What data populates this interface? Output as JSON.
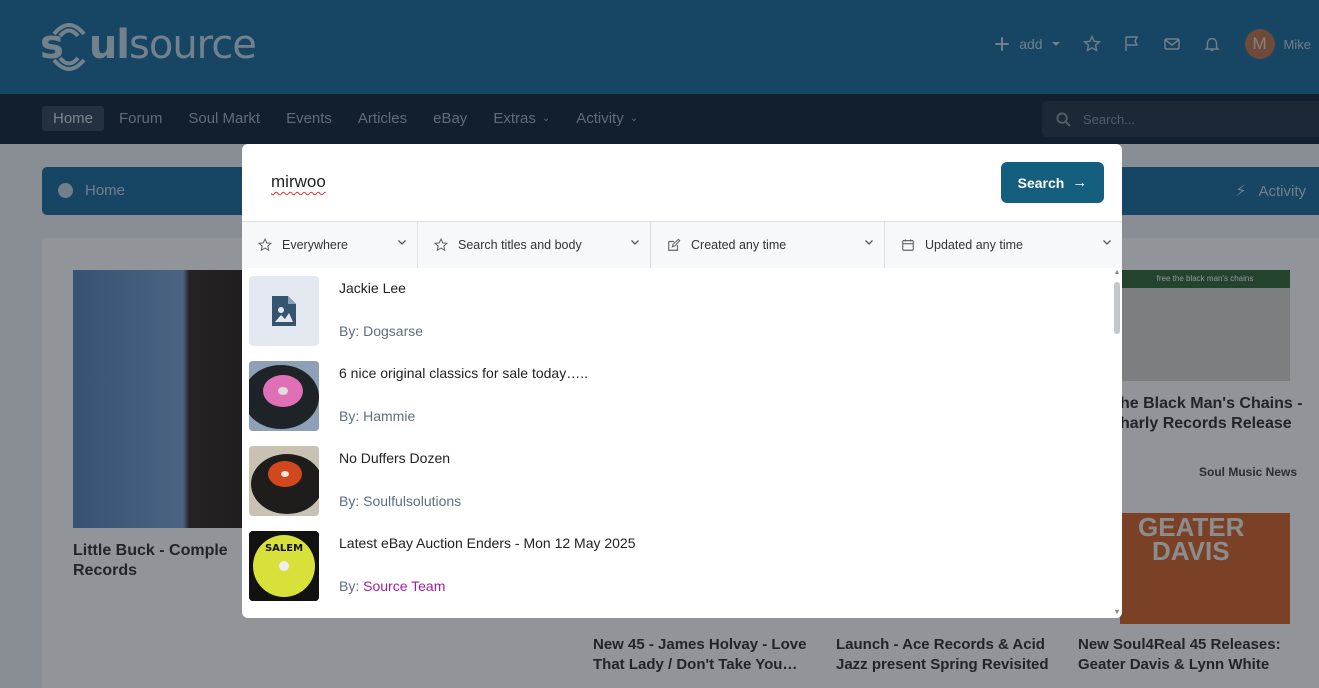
{
  "header": {
    "logo_left": "s",
    "logo_mid": "ul",
    "logo_right": "source",
    "add_label": "add",
    "user_initial": "M",
    "user_name": "Mike",
    "icons": [
      "plus-icon",
      "chevron-down-icon",
      "star-icon",
      "flag-icon",
      "envelope-icon",
      "bell-icon"
    ]
  },
  "nav": {
    "items": [
      {
        "label": "Home",
        "active": true
      },
      {
        "label": "Forum"
      },
      {
        "label": "Soul Markt"
      },
      {
        "label": "Events"
      },
      {
        "label": "Articles"
      },
      {
        "label": "eBay"
      },
      {
        "label": "Extras",
        "dropdown": true
      },
      {
        "label": "Activity",
        "dropdown": true
      }
    ],
    "search_placeholder": "Search..."
  },
  "breadcrumb": {
    "home": "Home",
    "activity": "Activity"
  },
  "background_cards": {
    "card1_title": "Little Buck - Comple",
    "card1_title2": "Records",
    "card2_title": "New 45 - James Holvay - Love",
    "card2_title2": "That Lady / Don't Take You…",
    "card3_title": "Launch - Ace Records & Acid",
    "card3_title2": "Jazz present Spring Revisited",
    "card4_title": "New Soul4Real 45 Releases:",
    "card4_title2": "Geater Davis & Lynn White",
    "card5_title": "he Black Man's Chains -",
    "card5_title2": "harly Records Release",
    "card5_tag": "Soul Music News",
    "thumb_text_1": "free the black man's chains",
    "thumb_text_2": "GEATER",
    "thumb_text_3": "DAVIS"
  },
  "search_modal": {
    "query": "mirwoo",
    "button_label": "Search",
    "filters": [
      {
        "label": "Everywhere",
        "icon": "star-icon"
      },
      {
        "label": "Search titles and body",
        "icon": "star-icon"
      },
      {
        "label": "Created any time",
        "icon": "edit-icon"
      },
      {
        "label": "Updated any time",
        "icon": "calendar-icon"
      }
    ],
    "results": [
      {
        "title": "Jackie Lee",
        "by_prefix": "By:",
        "author": "Dogsarse",
        "staff": false,
        "thumb": "placeholder-image-icon"
      },
      {
        "title": "6 nice original classics for sale today…..",
        "by_prefix": "By:",
        "author": "Hammie",
        "staff": false,
        "thumb": "pink-record"
      },
      {
        "title": "No Duffers Dozen",
        "by_prefix": "By:",
        "author": "Soulfulsolutions",
        "staff": false,
        "thumb": "red-record"
      },
      {
        "title": "Latest eBay Auction Enders - Mon 12 May 2025",
        "by_prefix": "By:",
        "author": "Source Team",
        "staff": true,
        "thumb": "salem-record",
        "label_text": "SALEM"
      }
    ]
  },
  "colors": {
    "header_bg": "#1f6f9b",
    "nav_bg": "#17293d",
    "search_button": "#135f7d",
    "staff_author": "#a21d9e"
  }
}
